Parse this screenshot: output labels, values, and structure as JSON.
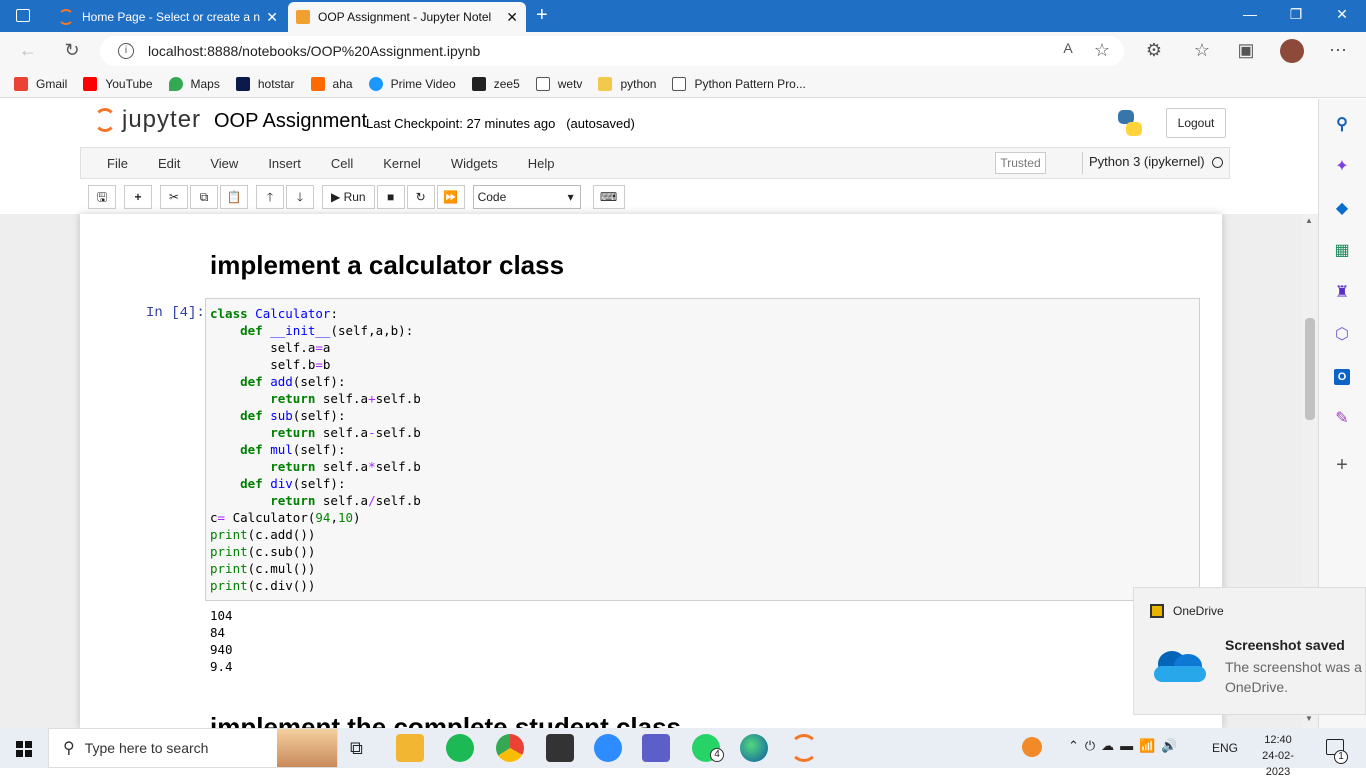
{
  "browser": {
    "tabs": [
      {
        "title": "Home Page - Select or create a n"
      },
      {
        "title": "OOP Assignment - Jupyter Notel"
      }
    ],
    "url": "localhost:8888/notebooks/OOP%20Assignment.ipynb",
    "bookmarks": [
      {
        "label": "Gmail",
        "color": "#ea4335"
      },
      {
        "label": "YouTube",
        "color": "#ff0000"
      },
      {
        "label": "Maps",
        "color": "#34a853"
      },
      {
        "label": "hotstar",
        "color": "#0c1a4b"
      },
      {
        "label": "aha",
        "color": "#ff6a00"
      },
      {
        "label": "Prime Video",
        "color": "#1a98ff"
      },
      {
        "label": "zee5",
        "color": "#222222"
      },
      {
        "label": "wetv",
        "color": "#ffffff"
      },
      {
        "label": "python",
        "color": "#f2c94c"
      },
      {
        "label": "Python Pattern Pro...",
        "color": "#ffffff"
      }
    ]
  },
  "jupyter": {
    "logo_text": "jupyter",
    "notebook_name": "OOP Assignment",
    "checkpoint": "Last Checkpoint: 27 minutes ago",
    "autosave": "(autosaved)",
    "logout": "Logout",
    "menus": [
      "File",
      "Edit",
      "View",
      "Insert",
      "Cell",
      "Kernel",
      "Widgets",
      "Help"
    ],
    "trusted": "Trusted",
    "kernel": "Python 3 (ipykernel)",
    "run_label": "Run",
    "cell_type": "Code"
  },
  "notebook": {
    "heading1": "implement a calculator class",
    "prompt": "In [4]:",
    "output": "104\n84\n940\n9.4",
    "heading2": "implement the complete student class"
  },
  "toast": {
    "app": "OneDrive",
    "title": "Screenshot saved",
    "body_line1": "The screenshot was a",
    "body_line2": "OneDrive."
  },
  "taskbar": {
    "search_placeholder": "Type here to search",
    "language": "ENG",
    "time": "12:40",
    "date": "24-02-2023",
    "whatsapp_badge": "4",
    "notification_count": "1"
  }
}
